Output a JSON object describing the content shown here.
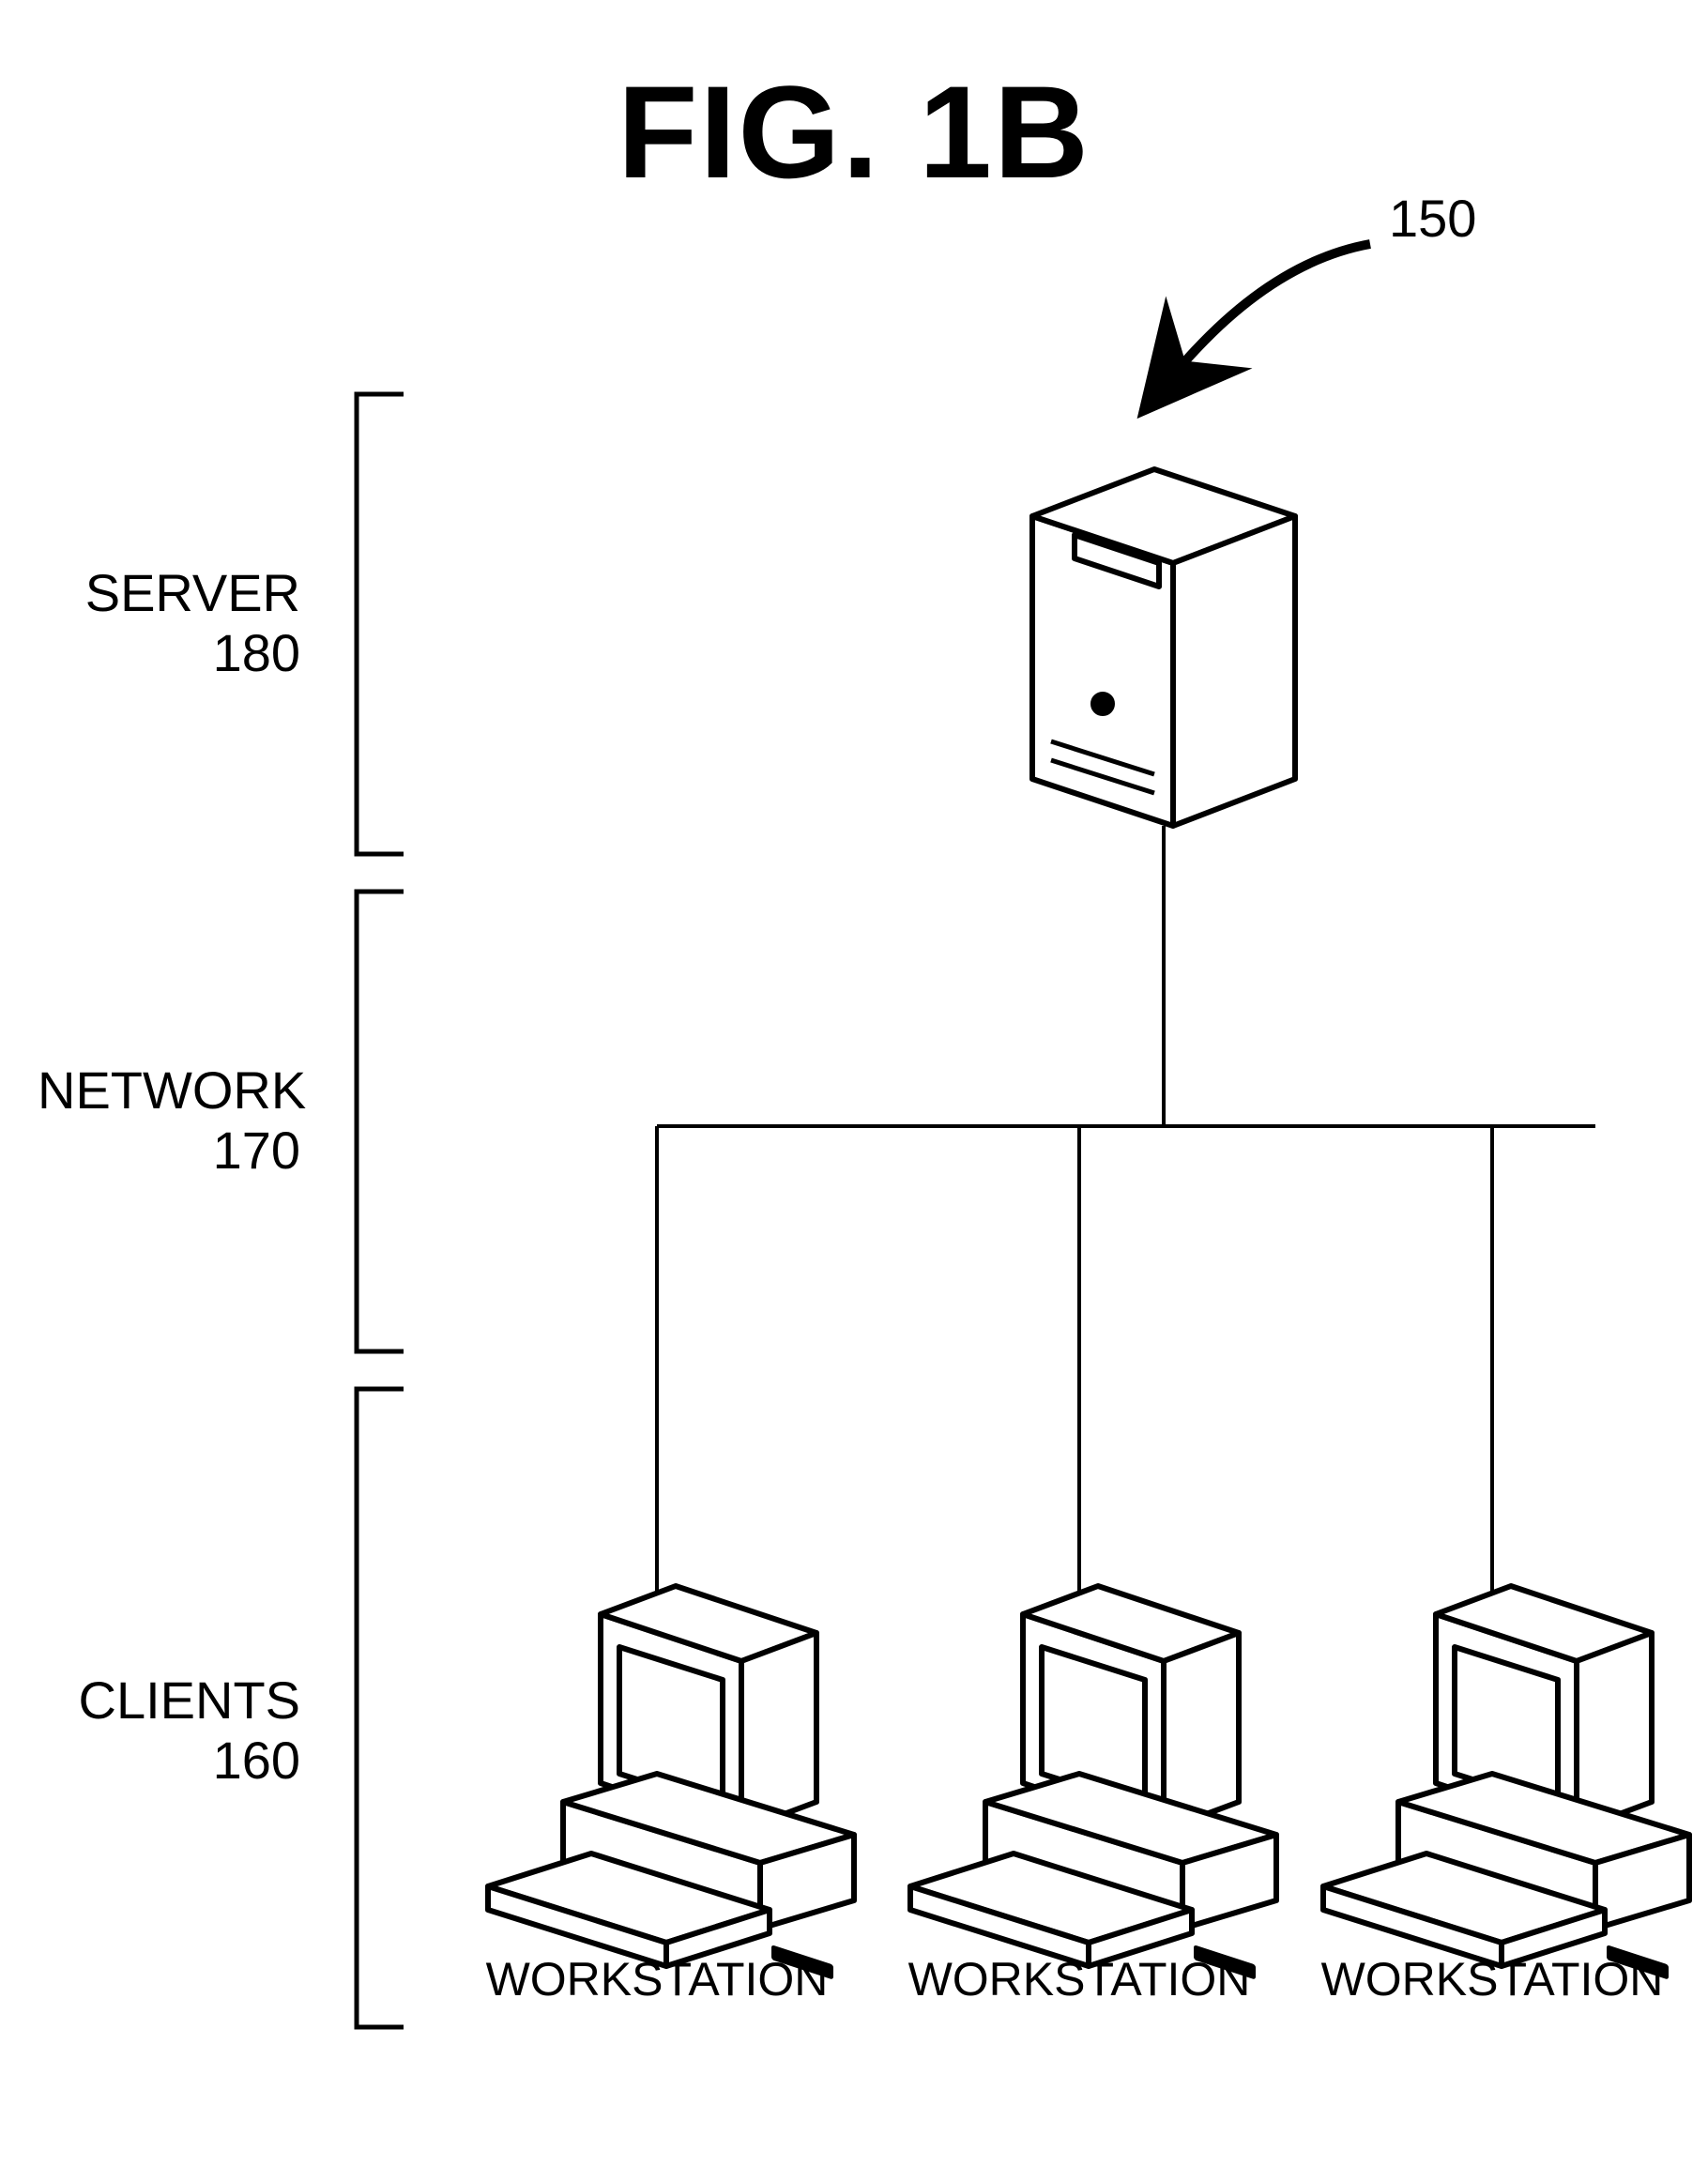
{
  "figure": {
    "title": "FIG. 1B",
    "reference_number": "150"
  },
  "tiers": {
    "server": {
      "label_line1": "SERVER",
      "label_line2": "180"
    },
    "network": {
      "label_line1": "NETWORK",
      "label_line2": "170"
    },
    "clients": {
      "label_line1": "CLIENTS",
      "label_line2": "160"
    }
  },
  "workstations": {
    "ws1": "WORKSTATION",
    "ws2": "WORKSTATION",
    "ws3": "WORKSTATION"
  }
}
